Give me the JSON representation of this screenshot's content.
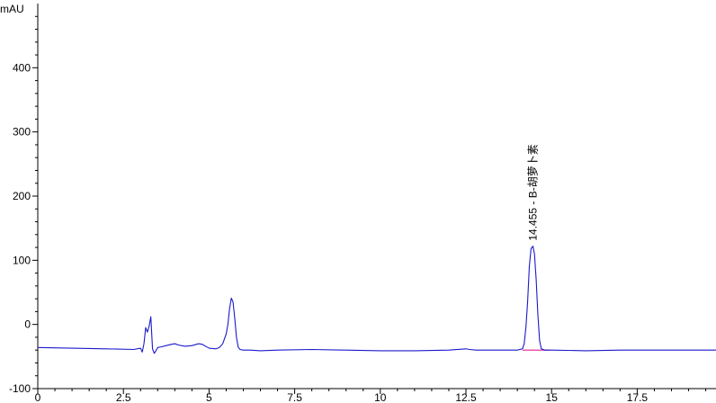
{
  "chart_data": {
    "type": "line",
    "ylabel": "mAU",
    "xlabel": "",
    "title": "",
    "xlim": [
      0,
      19.8
    ],
    "ylim": [
      -100,
      500
    ],
    "x_ticks": [
      0,
      2.5,
      5,
      7.5,
      10,
      12.5,
      15,
      17.5
    ],
    "x_tick_labels": [
      "0",
      "2.5",
      "5",
      "7.5",
      "10",
      "12.5",
      "15",
      "17.5"
    ],
    "y_ticks": [
      -100,
      0,
      100,
      200,
      300,
      400
    ],
    "y_tick_labels": [
      "-100",
      "0",
      "100",
      "200",
      "300",
      "400"
    ],
    "grid": false,
    "legend": "none",
    "line_color": "#1a1acc",
    "baseline_color": "#e0208f",
    "series": [
      {
        "name": "",
        "x": [
          0,
          1.0,
          2.0,
          2.8,
          3.0,
          3.05,
          3.1,
          3.15,
          3.2,
          3.25,
          3.3,
          3.35,
          3.4,
          3.45,
          3.5,
          3.6,
          3.75,
          3.9,
          4.0,
          4.1,
          4.3,
          4.5,
          4.7,
          4.8,
          4.9,
          5.0,
          5.2,
          5.3,
          5.4,
          5.5,
          5.55,
          5.6,
          5.65,
          5.7,
          5.75,
          5.8,
          5.85,
          5.9,
          6.0,
          6.2,
          6.5,
          7.0,
          8.0,
          9.0,
          10.0,
          11.0,
          12.0,
          12.5,
          12.6,
          12.8,
          13.5,
          14.0,
          14.15,
          14.2,
          14.25,
          14.3,
          14.35,
          14.4,
          14.455,
          14.5,
          14.55,
          14.6,
          14.65,
          14.7,
          14.8,
          15.0,
          16.0,
          17.0,
          18.0,
          19.0,
          19.8
        ],
        "values": [
          -36,
          -37,
          -38,
          -39,
          -37,
          -43,
          -30,
          -5,
          -12,
          -3,
          12,
          -38,
          -45,
          -41,
          -36,
          -35,
          -33,
          -31,
          -30,
          -32,
          -34,
          -33,
          -30,
          -31,
          -34,
          -37,
          -38,
          -36,
          -30,
          -15,
          0,
          25,
          41,
          35,
          10,
          -20,
          -35,
          -39,
          -40,
          -40,
          -41,
          -40,
          -39,
          -40,
          -41,
          -41,
          -40,
          -38,
          -39,
          -40,
          -40,
          -40,
          -38,
          -30,
          -5,
          35,
          90,
          118,
          122,
          110,
          70,
          15,
          -25,
          -38,
          -40,
          -40,
          -41,
          -40,
          -40,
          -40,
          -40
        ]
      }
    ],
    "peak_annotations": [
      {
        "x": 14.455,
        "y": 122,
        "label": "14.455 - B-胡萝卜素"
      }
    ],
    "integration_baseline": {
      "x_start": 14.15,
      "x_end": 14.95,
      "y_start": -40,
      "y_end": -40
    }
  }
}
